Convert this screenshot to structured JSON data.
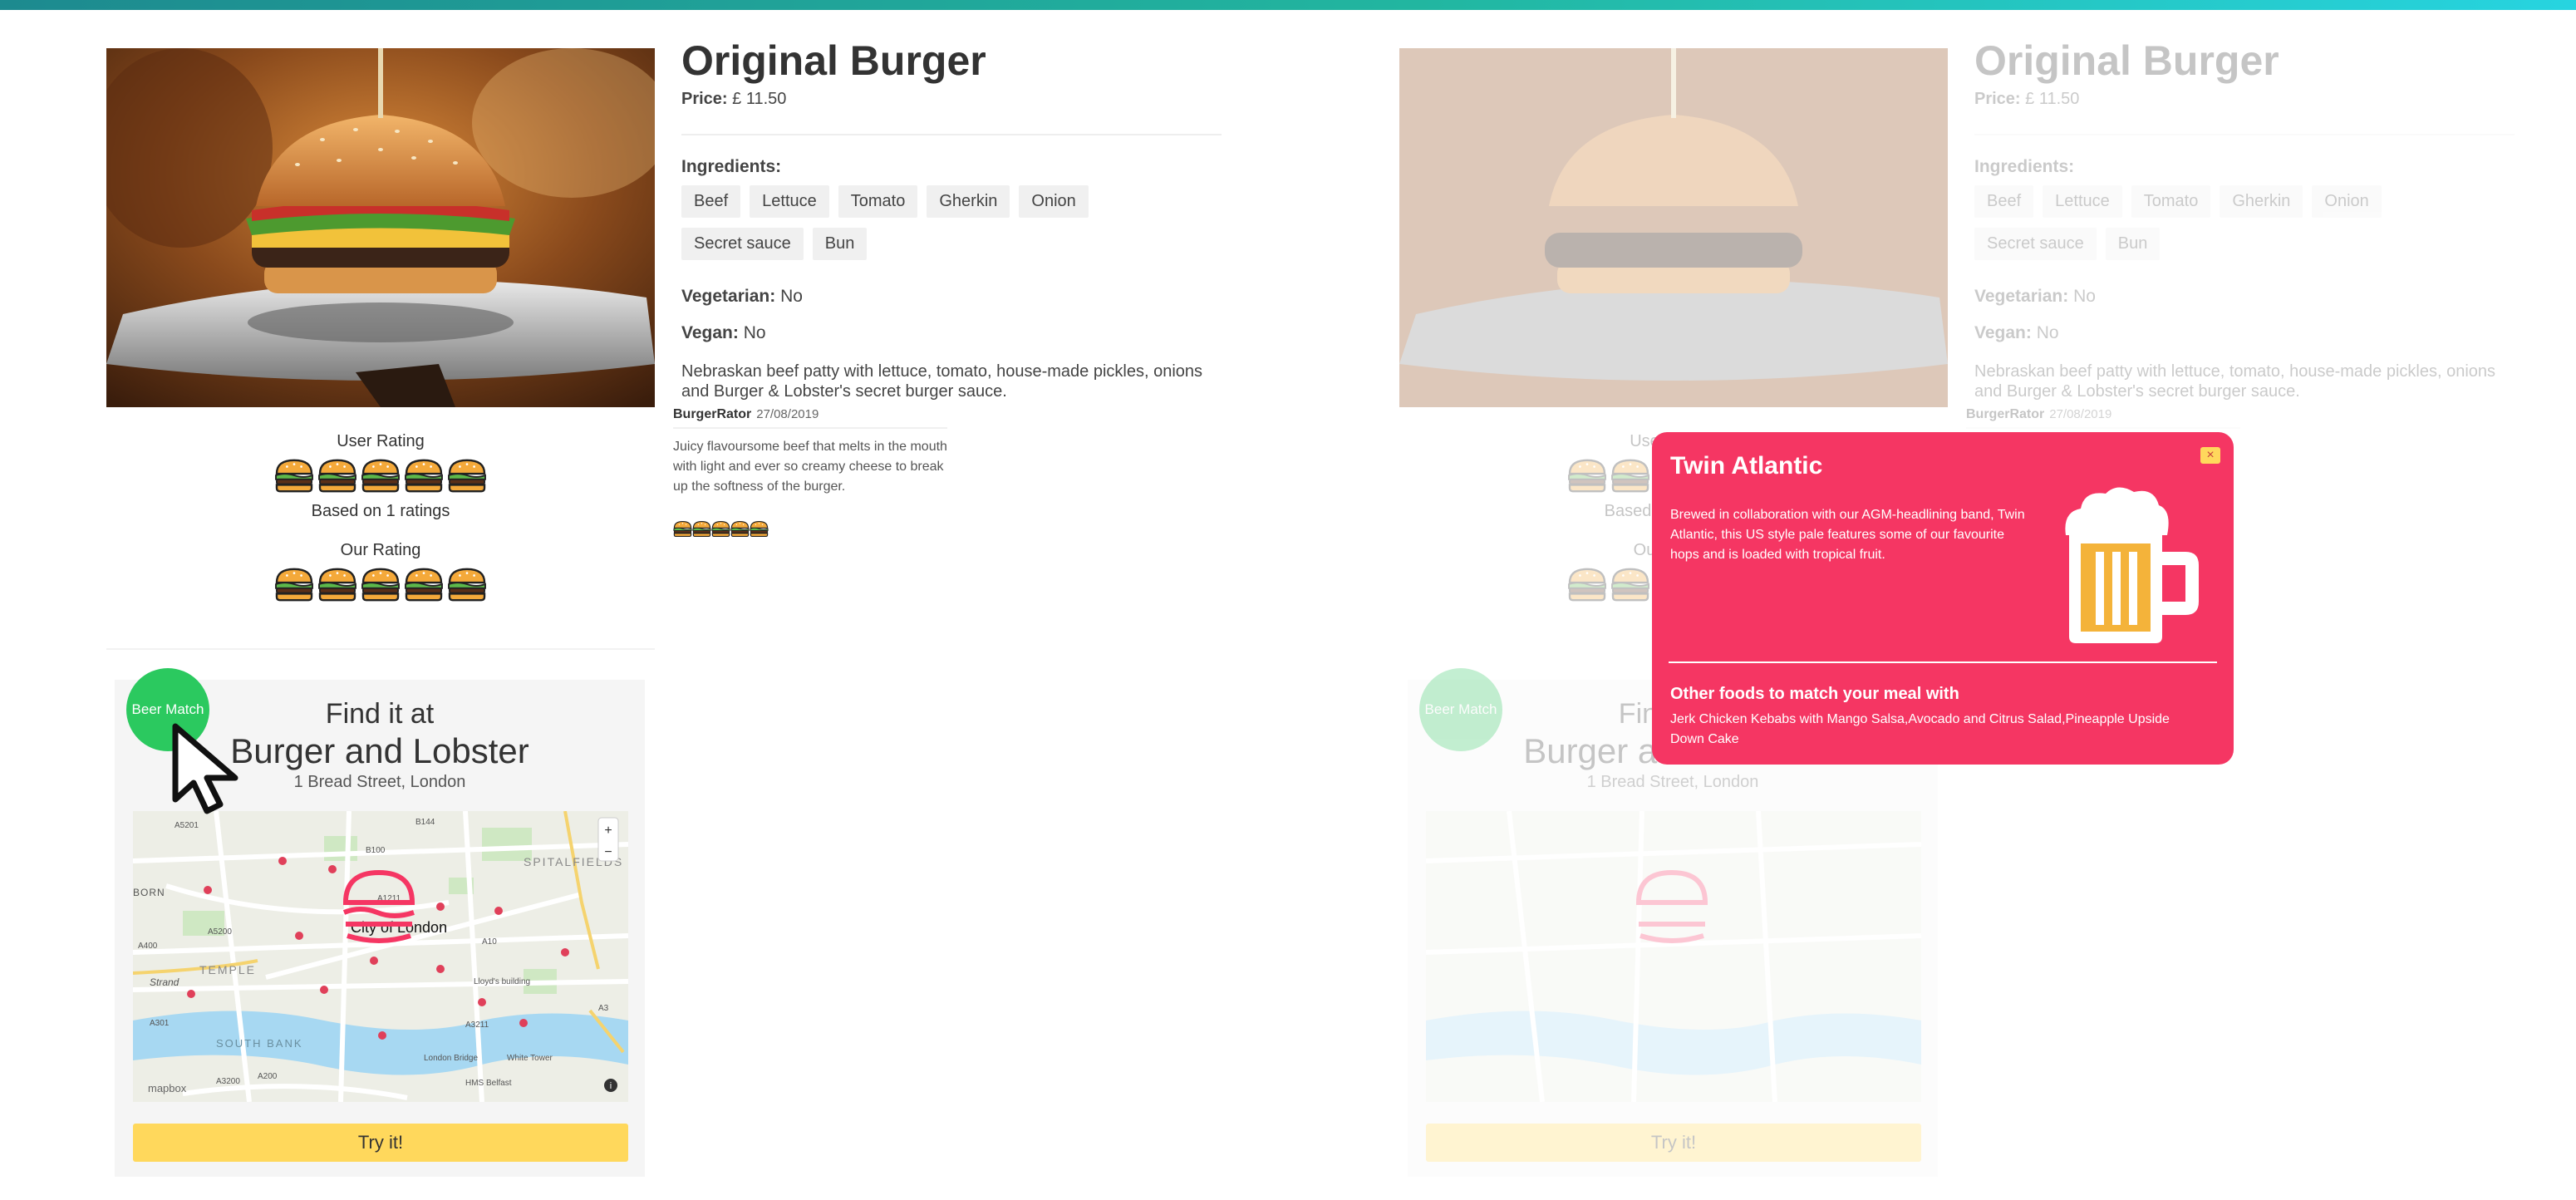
{
  "product": {
    "title": "Original Burger",
    "price_label": "Price:",
    "price_value": "£ 11.50",
    "ingredients_label": "Ingredients:",
    "ingredients": [
      "Beef",
      "Lettuce",
      "Tomato",
      "Gherkin",
      "Onion",
      "Secret sauce",
      "Bun"
    ],
    "vegetarian_label": "Vegetarian:",
    "vegetarian_value": "No",
    "vegan_label": "Vegan:",
    "vegan_value": "No",
    "description": "Nebraskan beef patty with lettuce, tomato, house-made pickles, onions and Burger & Lobster's secret burger sauce."
  },
  "review": {
    "author": "BurgerRator",
    "date": "27/08/2019",
    "text": "Juicy flavoursome beef that melts in the mouth with light and ever so creamy cheese to break up the softness of the burger.",
    "rating": 5
  },
  "ratings": {
    "user_label": "User Rating",
    "user_value": 5,
    "based_on": "Based on 1 ratings",
    "our_label": "Our Rating",
    "our_value": 5
  },
  "location": {
    "find_label": "Find it at",
    "venue": "Burger and Lobster",
    "address": "1 Bread Street, London",
    "try_label": "Try it!",
    "map_labels": {
      "city": "City of London",
      "spitalfields": "SPITALFIELDS",
      "temple": "TEMPLE",
      "south_bank": "SOUTH BANK",
      "strand": "Strand",
      "lloyds": "Lloyd's building",
      "london_bridge": "London Bridge",
      "hms_belfast": "HMS Belfast",
      "white_tower": "White Tower",
      "born": "BORN",
      "mapbox": "mapbox",
      "roads": [
        "A5201",
        "B144",
        "B100",
        "A1211",
        "A400",
        "A5200",
        "A10",
        "A3211",
        "A301",
        "A3200",
        "A200",
        "A3"
      ]
    },
    "zoom_in": "+",
    "zoom_out": "−",
    "info": "i"
  },
  "beer_match": {
    "label": "Beer Match"
  },
  "popup": {
    "title": "Twin Atlantic",
    "description": "Brewed in collaboration with our AGM-headlining band, Twin Atlantic, this US style pale features some of our favourite hops and is loaded with tropical fruit.",
    "close_label": "×",
    "other_foods_label": "Other foods to match your meal with",
    "other_foods": "Jerk Chicken Kebabs with Mango Salsa,Avocado and Citrus Salad,Pineapple Upside Down Cake"
  },
  "colors": {
    "accent_green": "#2bc95f",
    "button_yellow": "#ffd85c",
    "popup_pink": "#f53663",
    "topbar_teal": "#22b6a0"
  },
  "icons": {
    "rating": "burger-icon",
    "beer": "beer-mug-icon",
    "cursor": "mouse-cursor-icon",
    "map_pin": "burger-pin-icon"
  }
}
